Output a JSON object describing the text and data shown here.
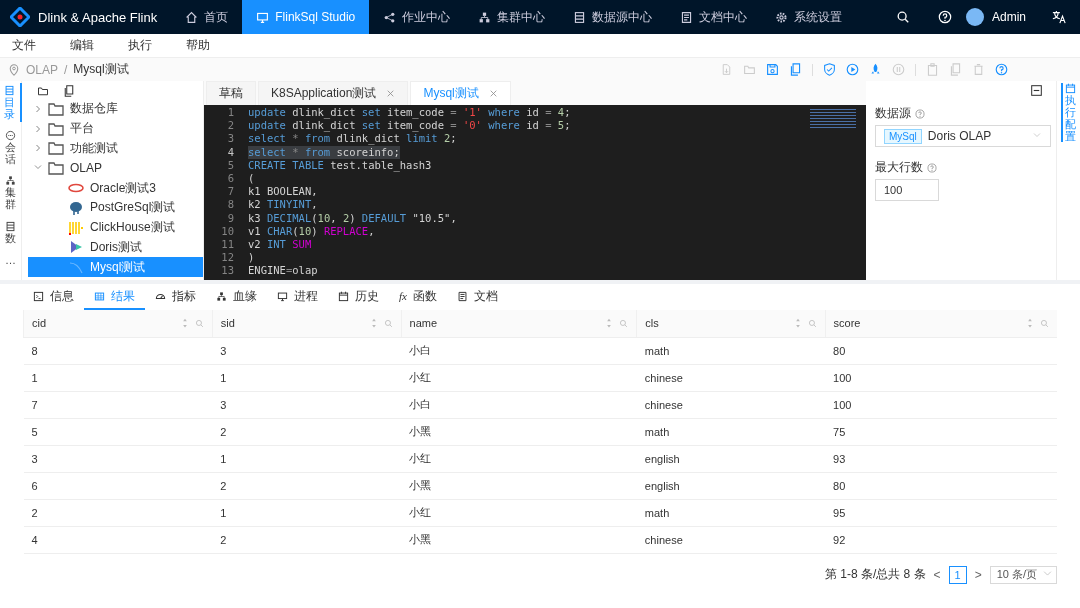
{
  "header": {
    "brand": "Dlink & Apache Flink",
    "nav": [
      {
        "label": "首页",
        "kind": "home",
        "selected": false
      },
      {
        "label": "FlinkSql Studio",
        "kind": "monitor",
        "selected": true
      },
      {
        "label": "作业中心",
        "kind": "share",
        "selected": false
      },
      {
        "label": "集群中心",
        "kind": "cluster",
        "selected": false
      },
      {
        "label": "数据源中心",
        "kind": "list",
        "selected": false
      },
      {
        "label": "文档中心",
        "kind": "doc",
        "selected": false
      },
      {
        "label": "系统设置",
        "kind": "gear",
        "selected": false
      }
    ],
    "user": "Admin"
  },
  "menu": [
    "文件",
    "编辑",
    "执行",
    "帮助"
  ],
  "breadcrumb": {
    "items": [
      "OLAP",
      "Mysql测试"
    ],
    "separator": "/"
  },
  "toolbar": [
    {
      "kind": "file",
      "disabled": true
    },
    {
      "kind": "folder",
      "disabled": true
    },
    {
      "kind": "save",
      "disabled": false
    },
    {
      "kind": "copy",
      "disabled": false
    },
    {
      "kind": "shield",
      "disabled": false
    },
    {
      "kind": "play",
      "disabled": false
    },
    {
      "kind": "rocket",
      "disabled": false
    },
    {
      "kind": "pause",
      "disabled": true
    },
    {
      "kind": "clip",
      "disabled": true
    },
    {
      "kind": "copy",
      "disabled": true
    },
    {
      "kind": "trash",
      "disabled": true
    },
    {
      "kind": "help",
      "disabled": false
    }
  ],
  "left_strip": [
    {
      "label": "目录",
      "kind": "list",
      "selected": true
    },
    {
      "label": "会话",
      "kind": "chat",
      "selected": false
    },
    {
      "label": "集群",
      "kind": "cluster",
      "selected": false
    },
    {
      "label": "数",
      "kind": "list",
      "selected": false
    },
    {
      "label": "…",
      "kind": "more",
      "selected": false
    }
  ],
  "tree": [
    {
      "label": "数据仓库",
      "kind": "folder",
      "expanded": false,
      "selected": false
    },
    {
      "label": "平台",
      "kind": "folder",
      "expanded": false,
      "selected": false
    },
    {
      "label": "功能测试",
      "kind": "folder",
      "expanded": false,
      "selected": false
    },
    {
      "label": "OLAP",
      "kind": "folder",
      "expanded": true,
      "selected": false,
      "children": [
        {
          "label": "Oracle测试3",
          "kind": "oracle",
          "selected": false
        },
        {
          "label": "PostGreSql测试",
          "kind": "postgres",
          "selected": false
        },
        {
          "label": "ClickHouse测试",
          "kind": "clickhouse",
          "selected": false
        },
        {
          "label": "Doris测试",
          "kind": "doris",
          "selected": false
        },
        {
          "label": "Mysql测试",
          "kind": "mysql",
          "selected": true
        }
      ]
    }
  ],
  "editor_tabs": [
    {
      "label": "草稿",
      "closable": false,
      "selected": false
    },
    {
      "label": "K8SApplication测试",
      "closable": true,
      "selected": false
    },
    {
      "label": "Mysql测试",
      "closable": true,
      "selected": true
    }
  ],
  "code": [
    {
      "number": "1",
      "highlighted": false,
      "tokens": [
        {
          "text": "update",
          "kind": "k"
        },
        {
          "text": " dlink_dict ",
          "kind": "p"
        },
        {
          "text": "set",
          "kind": "k"
        },
        {
          "text": " item_code ",
          "kind": "p"
        },
        {
          "text": "=",
          "kind": "o"
        },
        {
          "text": " '1' ",
          "kind": "s"
        },
        {
          "text": "where",
          "kind": "k"
        },
        {
          "text": " id ",
          "kind": "p"
        },
        {
          "text": "=",
          "kind": "o"
        },
        {
          "text": " 4",
          "kind": "n"
        },
        {
          "text": ";",
          "kind": "p"
        }
      ]
    },
    {
      "number": "2",
      "highlighted": false,
      "tokens": [
        {
          "text": "update",
          "kind": "k"
        },
        {
          "text": " dlink_dict ",
          "kind": "p"
        },
        {
          "text": "set",
          "kind": "k"
        },
        {
          "text": " item_code ",
          "kind": "p"
        },
        {
          "text": "=",
          "kind": "o"
        },
        {
          "text": " '0' ",
          "kind": "s"
        },
        {
          "text": "where",
          "kind": "k"
        },
        {
          "text": " id ",
          "kind": "p"
        },
        {
          "text": "=",
          "kind": "o"
        },
        {
          "text": " 5",
          "kind": "n"
        },
        {
          "text": ";",
          "kind": "p"
        }
      ]
    },
    {
      "number": "3",
      "highlighted": false,
      "tokens": [
        {
          "text": "select",
          "kind": "k"
        },
        {
          "text": " * ",
          "kind": "o"
        },
        {
          "text": "from",
          "kind": "k"
        },
        {
          "text": " dlink_dict ",
          "kind": "p"
        },
        {
          "text": "limit",
          "kind": "k"
        },
        {
          "text": " 2",
          "kind": "n"
        },
        {
          "text": ";",
          "kind": "p"
        }
      ]
    },
    {
      "number": "4",
      "highlighted": true,
      "tokens": [
        {
          "text": "select",
          "kind": "k"
        },
        {
          "text": " * ",
          "kind": "o"
        },
        {
          "text": "from",
          "kind": "k"
        },
        {
          "text": " scoreinfo;",
          "kind": "p"
        }
      ]
    },
    {
      "number": "5",
      "highlighted": false,
      "tokens": [
        {
          "text": "CREATE",
          "kind": "k"
        },
        {
          "text": " TABLE",
          "kind": "k"
        },
        {
          "text": " test.table_hash3",
          "kind": "p"
        }
      ]
    },
    {
      "number": "6",
      "highlighted": false,
      "tokens": [
        {
          "text": "(",
          "kind": "p"
        }
      ]
    },
    {
      "number": "7",
      "highlighted": false,
      "tokens": [
        {
          "text": "k1 BOOLEAN,",
          "kind": "p"
        }
      ]
    },
    {
      "number": "8",
      "highlighted": false,
      "tokens": [
        {
          "text": "k2 ",
          "kind": "p"
        },
        {
          "text": "TINYINT",
          "kind": "k"
        },
        {
          "text": ",",
          "kind": "p"
        }
      ]
    },
    {
      "number": "9",
      "highlighted": false,
      "tokens": [
        {
          "text": "k3 ",
          "kind": "p"
        },
        {
          "text": "DECIMAL",
          "kind": "k"
        },
        {
          "text": "(",
          "kind": "p"
        },
        {
          "text": "10",
          "kind": "n"
        },
        {
          "text": ", ",
          "kind": "p"
        },
        {
          "text": "2",
          "kind": "n"
        },
        {
          "text": ") ",
          "kind": "p"
        },
        {
          "text": "DEFAULT",
          "kind": "k"
        },
        {
          "text": " \"10.5\",",
          "kind": "p"
        }
      ]
    },
    {
      "number": "10",
      "highlighted": false,
      "tokens": [
        {
          "text": "v1 ",
          "kind": "p"
        },
        {
          "text": "CHAR",
          "kind": "k"
        },
        {
          "text": "(",
          "kind": "p"
        },
        {
          "text": "10",
          "kind": "n"
        },
        {
          "text": ") ",
          "kind": "p"
        },
        {
          "text": "REPLACE",
          "kind": "m"
        },
        {
          "text": ",",
          "kind": "p"
        }
      ]
    },
    {
      "number": "11",
      "highlighted": false,
      "tokens": [
        {
          "text": "v2 ",
          "kind": "p"
        },
        {
          "text": "INT ",
          "kind": "k"
        },
        {
          "text": "SUM",
          "kind": "m"
        }
      ]
    },
    {
      "number": "12",
      "highlighted": false,
      "tokens": [
        {
          "text": ")",
          "kind": "p"
        }
      ]
    },
    {
      "number": "13",
      "highlighted": false,
      "tokens": [
        {
          "text": "ENGINE",
          "kind": "p"
        },
        {
          "text": "=",
          "kind": "o"
        },
        {
          "text": "olap",
          "kind": "p"
        }
      ]
    }
  ],
  "config": {
    "fields": [
      {
        "label": "数据源",
        "kind": "select",
        "tag": "MySql",
        "value": "Doris OLAP"
      },
      {
        "label": "最大行数",
        "kind": "input",
        "value": "100"
      }
    ]
  },
  "right_strip": [
    {
      "label": "执行配置",
      "selected": true
    }
  ],
  "result_tabs": [
    {
      "label": "信息",
      "kind": "terminal",
      "selected": false
    },
    {
      "label": "结果",
      "kind": "table",
      "selected": true
    },
    {
      "label": "指标",
      "kind": "gauge",
      "selected": false
    },
    {
      "label": "血缘",
      "kind": "cluster",
      "selected": false
    },
    {
      "label": "进程",
      "kind": "monitor",
      "selected": false
    },
    {
      "label": "历史",
      "kind": "calendar",
      "selected": false
    },
    {
      "label": "函数",
      "kind": "fx",
      "glyph": "fx",
      "selected": false
    },
    {
      "label": "文档",
      "kind": "doc",
      "selected": false
    }
  ],
  "table": {
    "columns": [
      "cid",
      "sid",
      "name",
      "cls",
      "score"
    ],
    "rows": [
      [
        "8",
        "3",
        "小白",
        "math",
        "80"
      ],
      [
        "1",
        "1",
        "小红",
        "chinese",
        "100"
      ],
      [
        "7",
        "3",
        "小白",
        "chinese",
        "100"
      ],
      [
        "5",
        "2",
        "小黑",
        "math",
        "75"
      ],
      [
        "3",
        "1",
        "小红",
        "english",
        "93"
      ],
      [
        "6",
        "2",
        "小黑",
        "english",
        "80"
      ],
      [
        "2",
        "1",
        "小红",
        "math",
        "95"
      ],
      [
        "4",
        "2",
        "小黑",
        "chinese",
        "92"
      ]
    ]
  },
  "pagination": {
    "summary": "第 1-8 条/总共 8 条",
    "prev": "<",
    "pages": [
      {
        "label": "1",
        "selected": true
      }
    ],
    "next": ">",
    "page_size": "10 条/页"
  }
}
